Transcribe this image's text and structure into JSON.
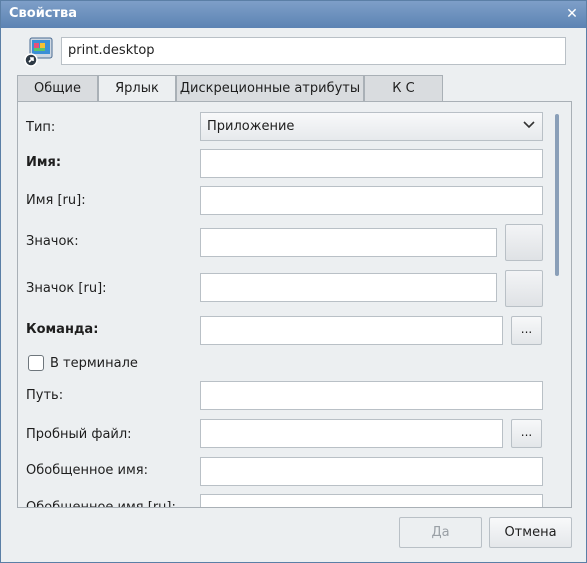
{
  "window": {
    "title": "Свойства",
    "close_glyph": "✕"
  },
  "file_name": "print.desktop",
  "tabs": [
    {
      "label": "Общие",
      "active": false
    },
    {
      "label": "Ярлык",
      "active": true
    },
    {
      "label": "Дискреционные атрибуты",
      "active": false
    },
    {
      "label": "К С",
      "active": false
    }
  ],
  "form": {
    "type_label": "Тип:",
    "type_value": "Приложение",
    "name_label": "Имя:",
    "name_ru_label": "Имя [ru]:",
    "icon_label": "Значок:",
    "icon_ru_label": "Значок [ru]:",
    "command_label": "Команда:",
    "browse_label": "...",
    "terminal_label": "В терминале",
    "terminal_checked": false,
    "path_label": "Путь:",
    "tryexec_label": "Пробный файл:",
    "generic_name_label": "Обобщенное имя:",
    "generic_name_ru_label": "Обобщенное имя [ru]:"
  },
  "buttons": {
    "ok": "Да",
    "cancel": "Отмена"
  },
  "icons": {
    "app": "desktop-shortcut-icon",
    "close": "close-icon",
    "chevron": "chevron-down-icon"
  }
}
